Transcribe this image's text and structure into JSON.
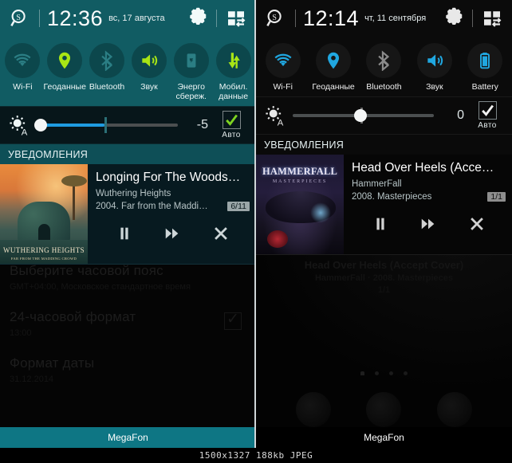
{
  "footer": {
    "info": "1500x1327 188kb JPEG"
  },
  "left": {
    "theme_accent": "#115c63",
    "status": {
      "search_icon": "search-icon",
      "clock": "12:36",
      "date": "вс, 17 августа",
      "gear_icon": "gear-icon",
      "grid_icon": "quick-settings-grid-icon"
    },
    "toggles": [
      {
        "label": "Wi-Fi",
        "icon": "wifi-icon",
        "active": false
      },
      {
        "label": "Геоданные",
        "icon": "location-pin-icon",
        "active": true
      },
      {
        "label": "Bluetooth",
        "icon": "bluetooth-icon",
        "active": false
      },
      {
        "label": "Звук",
        "icon": "sound-speaker-icon",
        "active": true
      },
      {
        "label": "Энерго сбереж.",
        "icon": "power-saving-icon",
        "active": false
      },
      {
        "label": "Мобил. данные",
        "icon": "mobile-data-icon",
        "active": true
      }
    ],
    "brightness": {
      "icon": "brightness-auto-icon",
      "value": "-5",
      "auto_label": "Авто",
      "auto_checked": true,
      "fill_percent": 48,
      "knob_percent": 3,
      "tick_percent": 48
    },
    "notifications_header": "УВЕДОМЛЕНИЯ",
    "now_playing": {
      "album_art_title": "WUTHERING HEIGHTS",
      "album_art_subtitle": "FAR FROM THE MADDING CROWD",
      "title": "Longing For The Woods…",
      "artist": "Wuthering Heights",
      "album": "2004. Far from the Maddi…",
      "badge": "6/11",
      "controls": [
        {
          "icon": "pause-icon",
          "name": "pause-button"
        },
        {
          "icon": "next-track-icon",
          "name": "next-button"
        },
        {
          "icon": "close-icon",
          "name": "dismiss-button"
        }
      ]
    },
    "background_settings": [
      {
        "title": "Выберите часовой пояс",
        "sub": "GMT+04:00, Московское стандартное время"
      },
      {
        "title": "24-часовой формат",
        "sub": "13:00"
      },
      {
        "title": "Формат даты",
        "sub": "31.12.2014"
      }
    ],
    "carrier": "MegaFon"
  },
  "right": {
    "theme_accent": "#0b0b0b",
    "status": {
      "search_icon": "search-icon",
      "clock": "12:14",
      "date": "чт, 11 сентября",
      "gear_icon": "gear-icon",
      "grid_icon": "quick-settings-grid-icon"
    },
    "toggles": [
      {
        "label": "Wi-Fi",
        "icon": "wifi-icon",
        "active": true
      },
      {
        "label": "Геоданные",
        "icon": "location-pin-icon",
        "active": true
      },
      {
        "label": "Bluetooth",
        "icon": "bluetooth-icon",
        "active": false
      },
      {
        "label": "Звук",
        "icon": "sound-speaker-icon",
        "active": true
      },
      {
        "label": "Battery",
        "icon": "battery-icon",
        "active": true
      }
    ],
    "brightness": {
      "icon": "brightness-auto-icon",
      "value": "0",
      "auto_label": "Авто",
      "auto_checked": true,
      "fill_percent": 0,
      "knob_percent": 48,
      "tick_percent": 48
    },
    "notifications_header": "УВЕДОМЛЕНИЯ",
    "now_playing": {
      "album_art_title": "HAMMERFALL",
      "album_art_subtitle": "MASTERPIECES",
      "title": "Head Over Heels (Acce…",
      "artist": "HammerFall",
      "album": "2008. Masterpieces",
      "badge": "1/1",
      "controls": [
        {
          "icon": "pause-icon",
          "name": "pause-button"
        },
        {
          "icon": "next-track-icon",
          "name": "next-button"
        },
        {
          "icon": "close-icon",
          "name": "dismiss-button"
        }
      ]
    },
    "background_now_playing": {
      "title": "Head Over Heels (Accept Cover)",
      "subtitle": "HammerFall · 2008. Masterpieces",
      "counter": "1/1"
    },
    "carrier": "MegaFon"
  }
}
